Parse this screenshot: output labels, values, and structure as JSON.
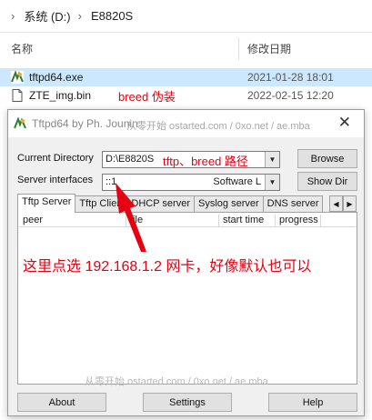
{
  "breadcrumb": {
    "segments": [
      "系统 (D:)",
      "E8820S"
    ]
  },
  "columns": {
    "name": "名称",
    "modified": "修改日期"
  },
  "files": [
    {
      "name": "tftpd64.exe",
      "date": "2021-01-28 18:01",
      "icon": "tftpd-app-icon"
    },
    {
      "name": "ZTE_img.bin",
      "date": "2022-02-15 12:20",
      "icon": "file-icon",
      "note": "breed 伪装"
    }
  ],
  "window": {
    "title": "Tftpd64 by Ph. Jounin",
    "watermark_top": "从零开始 ostarted.com / 0xo.net / ae.mba",
    "watermark_bottom": "从零开始 ostarted.com / 0xo.net / ae.mba",
    "close_glyph": "✕",
    "current_directory_label": "Current Directory",
    "current_directory_value": "D:\\E8820S",
    "server_interfaces_label": "Server interfaces",
    "server_interfaces_value": "::1",
    "server_interfaces_right": "Software L",
    "browse_button": "Browse",
    "show_dir_button": "Show Dir",
    "tabs": [
      "Tftp Server",
      "Tftp Client",
      "DHCP server",
      "Syslog server",
      "DNS server"
    ],
    "table_headers": [
      "peer",
      "file",
      "start time",
      "progress"
    ],
    "about_button": "About",
    "settings_button": "Settings",
    "help_button": "Help"
  },
  "annotations": {
    "path_note": "tftp、breed 路径",
    "choose_note": "这里点选 192.168.1.2 网卡，好像默认也可以"
  },
  "colors": {
    "annotation": "#e60012",
    "selected_row": "#cce8ff"
  }
}
